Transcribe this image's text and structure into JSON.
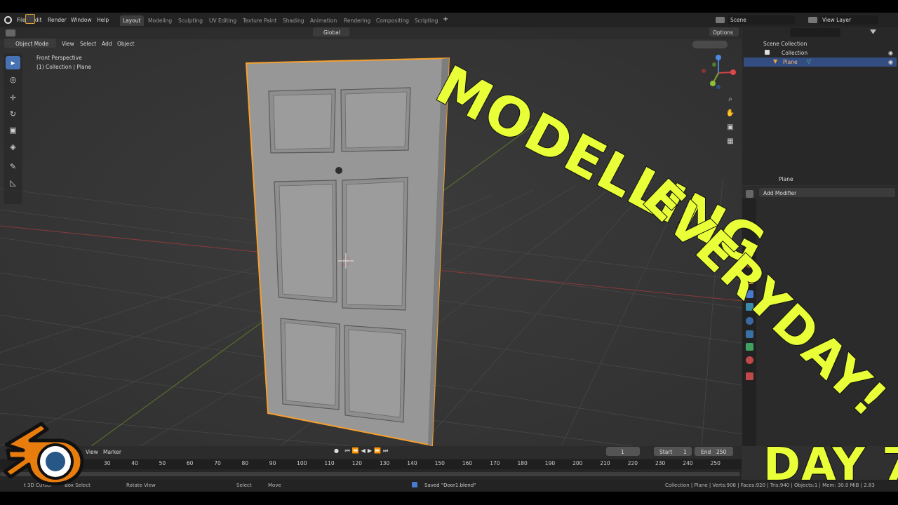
{
  "menubar": {
    "menus": [
      "File",
      "Edit",
      "Render",
      "Window",
      "Help"
    ],
    "workspaces": [
      "Layout",
      "Modeling",
      "Sculpting",
      "UV Editing",
      "Texture Paint",
      "Shading",
      "Animation",
      "Rendering",
      "Compositing",
      "Scripting"
    ],
    "active_workspace": "Layout",
    "add_tab": "+",
    "scene_label": "Scene",
    "view_layer_label": "View Layer"
  },
  "viewport_header": {
    "mode": "Object Mode",
    "menus": [
      "View",
      "Select",
      "Add",
      "Object"
    ],
    "orientation": "Global",
    "options": "Options"
  },
  "viewport_overlay": {
    "perspective": "Front Perspective",
    "collection_path": "(1) Collection | Plane"
  },
  "outliner": {
    "rows": [
      {
        "label": "Scene Collection"
      },
      {
        "label": "Collection"
      },
      {
        "label": "Plane",
        "selected": true
      }
    ]
  },
  "properties": {
    "object_name": "Plane",
    "add_modifier": "Add Modifier"
  },
  "timeline": {
    "menus": [
      "View",
      "Marker"
    ],
    "current_frame": "1",
    "start_label": "Start",
    "start_value": "1",
    "end_label": "End",
    "end_value": "250",
    "ruler": [
      "30",
      "40",
      "50",
      "60",
      "70",
      "80",
      "90",
      "100",
      "110",
      "120",
      "130",
      "140",
      "150",
      "160",
      "170",
      "180",
      "190",
      "200",
      "210",
      "220",
      "230",
      "240",
      "250"
    ]
  },
  "statusbar": {
    "cursor": "t 3D Cursor",
    "box_select": "Box Select",
    "rotate_view": "Rotate View",
    "select": "Select",
    "move": "Move",
    "saved": "Saved \"Door1.blend\"",
    "stats": "Collection | Plane | Verts:908 | Faces:920 | Tris:940 | Objects:1 | Mem: 30.0 MiB | 2.83"
  },
  "overlay_text": {
    "line1": "MODELLING",
    "line2": "EVERYDAY!",
    "day": "DAY 7"
  },
  "colors": {
    "accent": "#4772b3",
    "selection_outline": "#f5a030",
    "overlay_text": "#e9ff37"
  }
}
